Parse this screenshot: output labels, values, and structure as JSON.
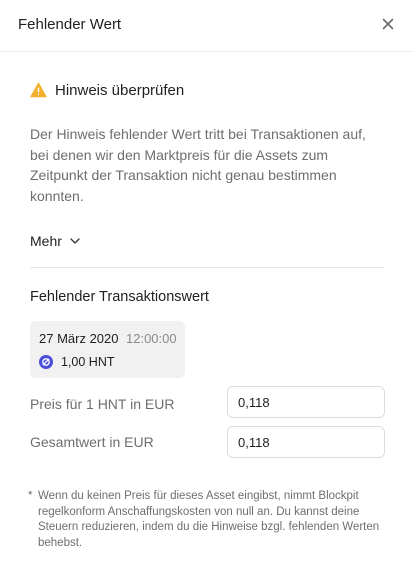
{
  "dialog": {
    "title": "Fehlender Wert",
    "close_icon": "close-icon"
  },
  "notice": {
    "icon": "warning-icon",
    "icon_color": "#F2B02E",
    "title": "Hinweis überprüfen",
    "description": "Der Hinweis fehlender Wert tritt bei Transaktionen auf, bei denen wir den Marktpreis für die Assets zum Zeitpunkt der Transaktion nicht genau bestimmen konnten.",
    "more_label": "Mehr"
  },
  "transaction": {
    "section_title": "Fehlender Transaktionswert",
    "date": "27 März 2020",
    "time": "12:00:00",
    "coin_icon": "helium-coin-icon",
    "coin_color": "#4B4EDB",
    "amount": "1,00 HNT"
  },
  "fields": {
    "price_label": "Preis für 1 HNT in EUR",
    "price_value": "0,118",
    "total_label": "Gesamtwert in EUR",
    "total_value": "0,118"
  },
  "footnote": {
    "marker": "*",
    "text": "Wenn du keinen Preis für dieses Asset eingibst, nimmt Blockpit regelkonform Anschaffungskosten von null an. Du kannst deine Steuern reduzieren, indem du die Hinweise bzgl. fehlenden Werten behebst."
  }
}
